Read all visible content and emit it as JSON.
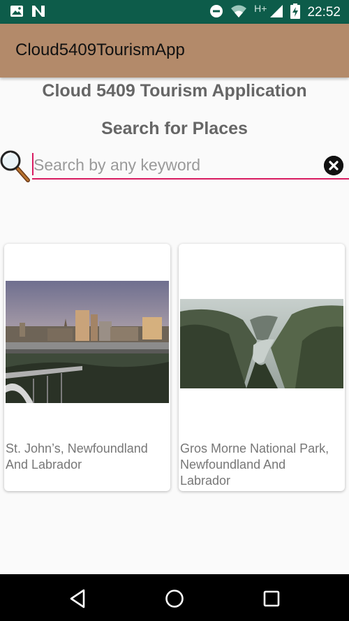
{
  "status_bar": {
    "time": "22:52",
    "network_label": "H+",
    "icons": [
      "image-icon",
      "n-notification-icon",
      "do-not-disturb-icon",
      "wifi-icon",
      "cell-signal-icon",
      "battery-charging-icon"
    ]
  },
  "app_bar": {
    "title": "Cloud5409TourismApp"
  },
  "main": {
    "heading": "Cloud 5409 Tourism Application",
    "subheading": "Search for Places"
  },
  "search": {
    "placeholder": "Search by any keyword",
    "value": "",
    "accent_color": "#d81b60"
  },
  "places": [
    {
      "title": "St. John’s, Newfoundland And Labrador"
    },
    {
      "title": "Gros Morne National Park, Newfoundland And Labrador"
    }
  ],
  "colors": {
    "status_bar": "#0d5c4a",
    "app_bar": "#b38a6a",
    "heading_text": "#666666",
    "nav_bar": "#000000"
  },
  "nav_bar": {
    "buttons": [
      "back-icon",
      "home-icon",
      "recents-icon"
    ]
  }
}
